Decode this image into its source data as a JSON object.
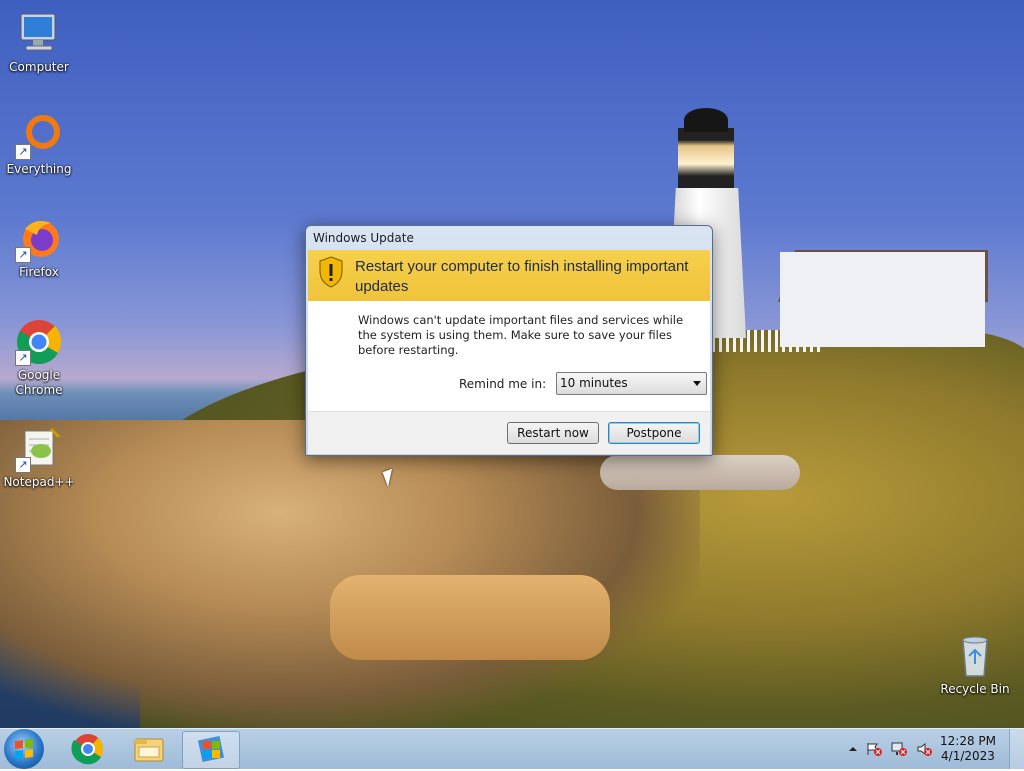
{
  "desktop": {
    "icons": [
      {
        "label": "Computer",
        "icon": "computer-icon"
      },
      {
        "label": "Everything",
        "icon": "everything-icon"
      },
      {
        "label": "Firefox",
        "icon": "firefox-icon"
      },
      {
        "label": "Google Chrome",
        "icon": "chrome-icon"
      },
      {
        "label": "Notepad++",
        "icon": "notepadpp-icon"
      },
      {
        "label": "Recycle Bin",
        "icon": "recycle-bin-icon"
      }
    ]
  },
  "dialog": {
    "title": "Windows Update",
    "heading": "Restart your computer to finish installing important updates",
    "message": "Windows can't update important files and services while the system is using them. Make sure to save your files before restarting.",
    "remind_label": "Remind me in:",
    "remind_value": "10 minutes",
    "restart_label": "Restart now",
    "postpone_label": "Postpone",
    "banner_color": "#f3c940"
  },
  "taskbar": {
    "pinned": [
      "start-orb",
      "chrome-icon",
      "file-explorer-icon",
      "windows-update-icon"
    ],
    "time": "12:28 PM",
    "date": "4/1/2023"
  }
}
